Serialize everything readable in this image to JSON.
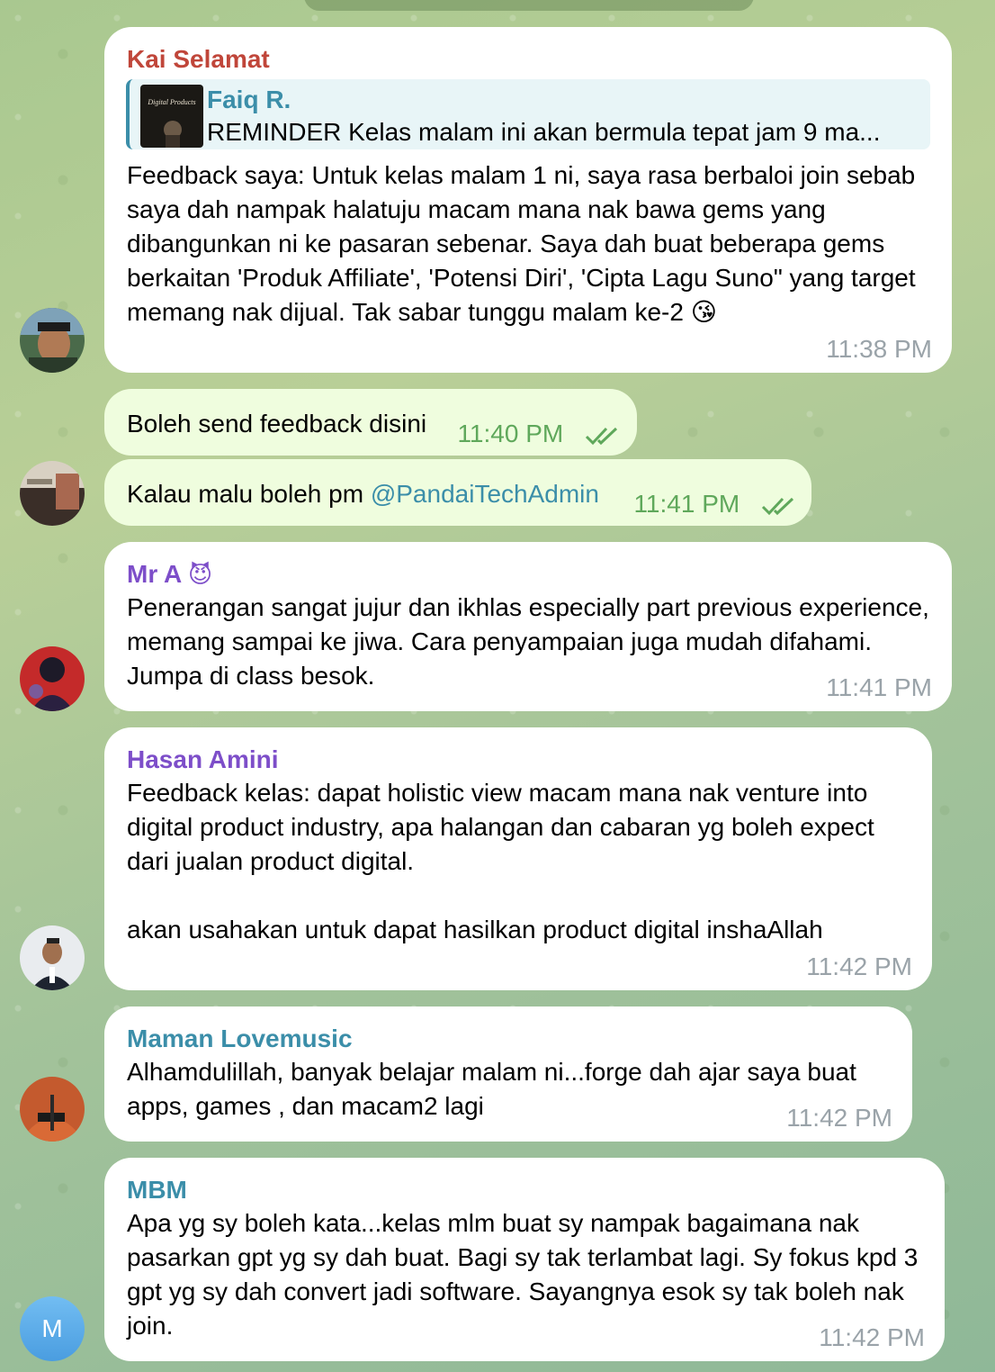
{
  "messages": {
    "kai": {
      "sender": "Kai Selamat",
      "reply_name": "Faiq R.",
      "reply_text": "REMINDER  Kelas malam ini akan bermula tepat jam 9 ma...",
      "thumb_text": "Digital Products",
      "text": "Feedback saya: Untuk kelas malam 1 ni, saya rasa berbaloi join sebab saya dah nampak halatuju macam mana nak bawa gems yang dibangunkan ni ke pasaran sebenar. Saya dah buat beberapa gems berkaitan 'Produk Affiliate', 'Potensi Diri', 'Cipta Lagu Suno\" yang target memang nak dijual. Tak sabar tunggu malam ke-2",
      "emoji": "😘",
      "time": "11:38 PM"
    },
    "own1": {
      "text": "Boleh send feedback disini",
      "time": "11:40 PM"
    },
    "own2": {
      "text": "Kalau malu boleh pm ",
      "mention": "@PandaiTechAdmin",
      "time": "11:41 PM"
    },
    "mra": {
      "sender": "Mr A",
      "badge": "😈",
      "text": "Penerangan sangat jujur dan ikhlas especially part previous experience, memang sampai ke jiwa. Cara penyampaian juga mudah difahami. Jumpa di class besok.",
      "time": "11:41 PM"
    },
    "hasan": {
      "sender": "Hasan Amini",
      "text": "Feedback kelas: dapat holistic view macam mana nak venture into digital product industry, apa halangan dan cabaran yg boleh expect dari jualan product digital.\n\nakan usahakan untuk dapat hasilkan product digital inshaAllah",
      "time": "11:42 PM"
    },
    "maman": {
      "sender": "Maman Lovemusic",
      "text": "Alhamdulillah, banyak belajar malam ni...forge dah ajar saya buat apps, games , dan macam2 lagi",
      "time": "11:42 PM"
    },
    "mbm": {
      "sender": "MBM",
      "avatar_letter": "M",
      "text": "Apa yg sy boleh kata...kelas mlm buat sy nampak bagaimana nak pasarkan gpt yg sy dah buat. Bagi sy tak terlambat lagi. Sy fokus kpd 3 gpt yg sy dah convert jadi software. Sayangnya esok sy tak boleh nak join.",
      "time": "11:42 PM"
    }
  },
  "colors": {
    "kai_name": "#c0463a",
    "faiq_name": "#3b8ea9",
    "mra_name": "#7d4ec9",
    "hasan_name": "#7d4ec9",
    "maman_name": "#3b8ea9",
    "mbm_name": "#3b8ea9",
    "outgoing_bubble": "#effdde",
    "timestamp_out": "#5fa85b"
  }
}
